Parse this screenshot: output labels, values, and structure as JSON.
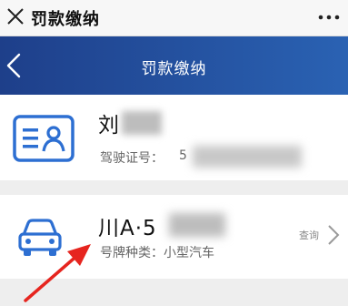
{
  "window": {
    "title": "罚款缴纳"
  },
  "nav": {
    "title": "罚款缴纳"
  },
  "driver": {
    "name": "刘",
    "license_label": "驾驶证号：",
    "license_partial": "5"
  },
  "vehicle": {
    "plate": "川A·5",
    "type_label": "号牌种类：小型汽车",
    "query_label": "查询"
  },
  "colors": {
    "accent": "#2d6fd2",
    "nav_start": "#1e3f8a",
    "nav_end": "#2a62b3",
    "annotation": "#e6251f"
  },
  "icons": [
    "close-icon",
    "more-icon",
    "back-icon",
    "license-card-icon",
    "car-icon",
    "chevron-right-icon"
  ]
}
